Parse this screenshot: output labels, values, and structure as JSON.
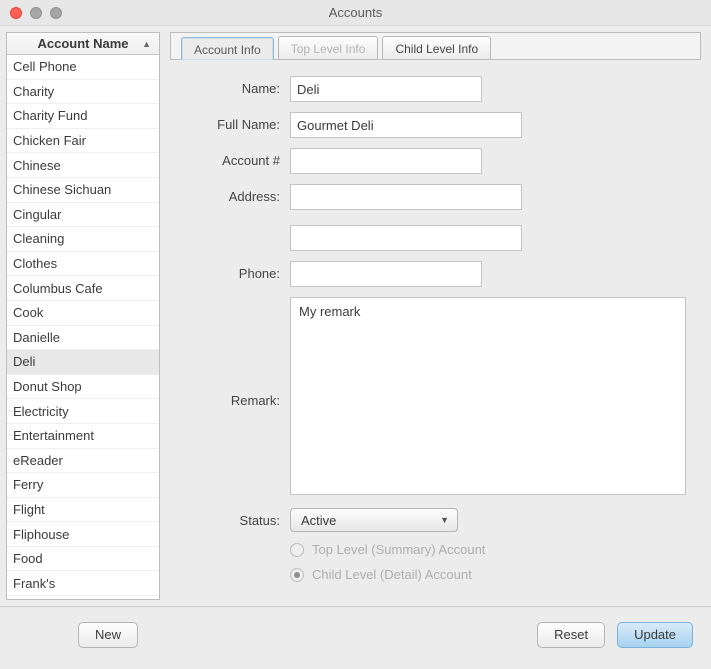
{
  "window": {
    "title": "Accounts"
  },
  "sidebar": {
    "header": "Account Name",
    "items": [
      "Cell Phone",
      "Charity",
      "Charity Fund",
      "Chicken Fair",
      "Chinese",
      "Chinese Sichuan",
      "Cingular",
      "Cleaning",
      "Clothes",
      "Columbus Cafe",
      "Cook",
      "Danielle",
      "Deli",
      "Donut Shop",
      "Electricity",
      "Entertainment",
      "eReader",
      "Ferry",
      "Flight",
      "Fliphouse",
      "Food",
      "Frank's"
    ],
    "selected": "Deli"
  },
  "tabs": {
    "0": {
      "label": "Account Info"
    },
    "1": {
      "label": "Top Level Info"
    },
    "2": {
      "label": "Child Level Info"
    }
  },
  "form": {
    "name": {
      "label": "Name:",
      "value": "Deli"
    },
    "fullname": {
      "label": "Full Name:",
      "value": "Gourmet Deli"
    },
    "accountnum": {
      "label": "Account #",
      "value": ""
    },
    "address": {
      "label": "Address:",
      "value": "",
      "value2": ""
    },
    "phone": {
      "label": "Phone:",
      "value": ""
    },
    "remark": {
      "label": "Remark:",
      "value": "My remark"
    },
    "status": {
      "label": "Status:",
      "value": "Active"
    },
    "radio": {
      "top": "Top Level (Summary) Account",
      "child": "Child Level (Detail) Account"
    }
  },
  "buttons": {
    "new": "New",
    "reset": "Reset",
    "update": "Update"
  }
}
